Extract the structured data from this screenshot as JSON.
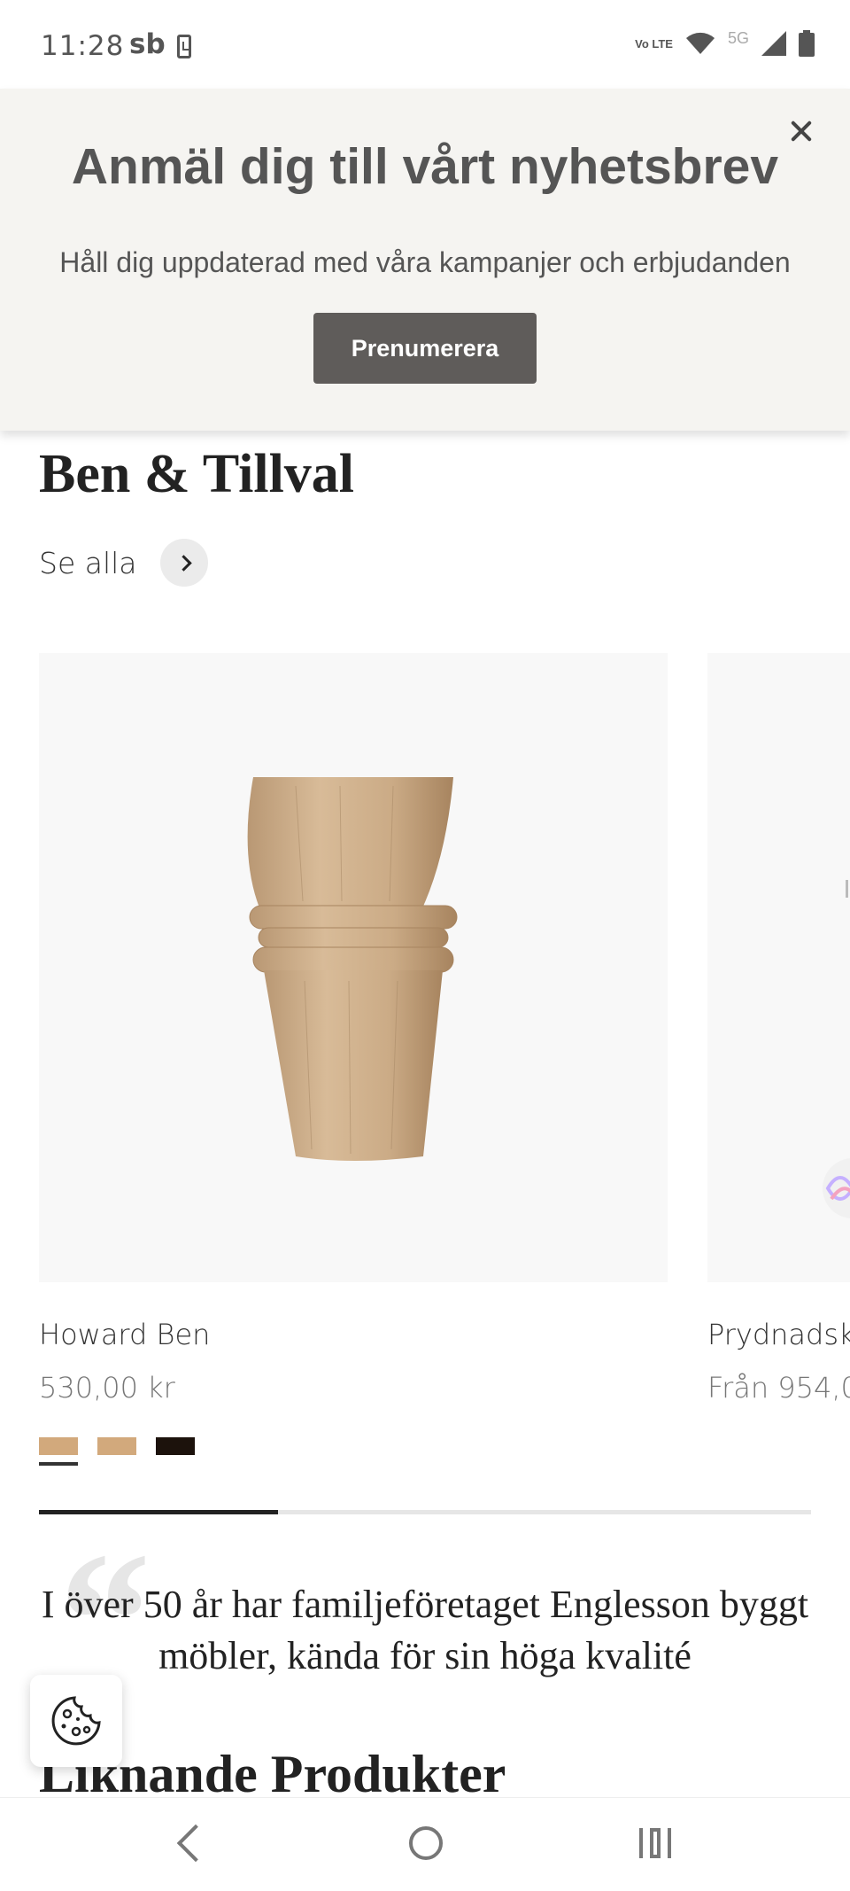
{
  "status_bar": {
    "time": "11:28",
    "carrier": "sb",
    "network_volte": "Vo LTE",
    "network_5g": "5G",
    "icons": [
      "phone-notification-icon",
      "volte-icon",
      "wifi-icon",
      "signal-icon",
      "battery-icon"
    ]
  },
  "newsletter": {
    "title": "Anmäl dig till vårt nyhetsbrev",
    "subtitle": "Håll dig uppdaterad med våra kampanjer och erbjudanden",
    "button_label": "Prenumerera"
  },
  "section": {
    "title": "Ben & Tillval",
    "see_all_label": "Se alla"
  },
  "products": [
    {
      "name": "Howard Ben",
      "price": "530,00 kr",
      "swatches": [
        "#d2a97c",
        "#d2a97c",
        "#1c120c"
      ],
      "selected_swatch": 0
    },
    {
      "name": "Prydnadsk",
      "price": "Från 954,0"
    }
  ],
  "carousel": {
    "progress": 0.31
  },
  "quote": {
    "text": "I över 50 år har familjeföretaget Englesson byggt möbler, kända för sin höga kvalité"
  },
  "related": {
    "title": "Liknande Produkter"
  },
  "colors": {
    "banner_bg": "#f5f4f1",
    "button_bg": "#5f5c5a",
    "card_bg": "#f8f8f8"
  }
}
